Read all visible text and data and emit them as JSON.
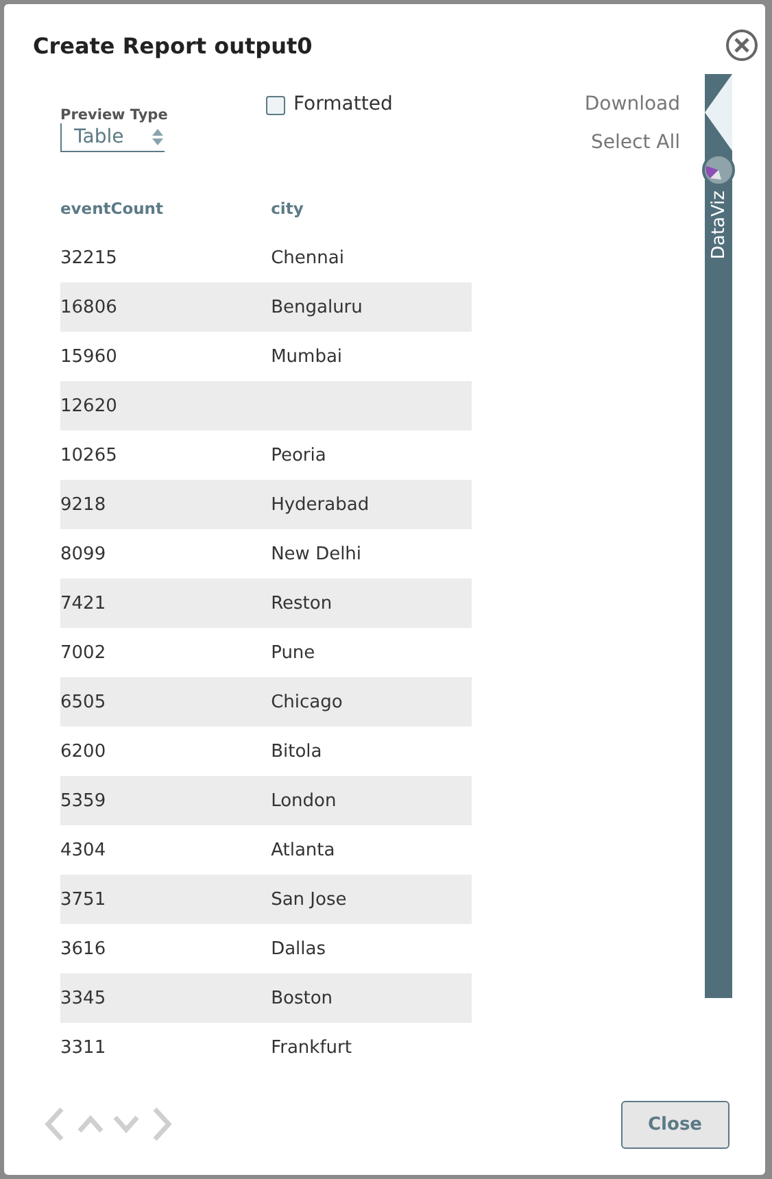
{
  "dialog": {
    "title": "Create Report output0"
  },
  "preview_type": {
    "label": "Preview Type",
    "value": "Table"
  },
  "formatted": {
    "label": "Formatted",
    "checked": false
  },
  "actions": [
    "Download",
    "Select All"
  ],
  "side_tab": {
    "label": "DataViz"
  },
  "table": {
    "columns": [
      "eventCount",
      "city"
    ],
    "rows": [
      [
        "32215",
        "Chennai"
      ],
      [
        "16806",
        "Bengaluru"
      ],
      [
        "15960",
        "Mumbai"
      ],
      [
        "12620",
        ""
      ],
      [
        "10265",
        "Peoria"
      ],
      [
        "9218",
        "Hyderabad"
      ],
      [
        "8099",
        "New Delhi"
      ],
      [
        "7421",
        "Reston"
      ],
      [
        "7002",
        "Pune"
      ],
      [
        "6505",
        "Chicago"
      ],
      [
        "6200",
        "Bitola"
      ],
      [
        "5359",
        "London"
      ],
      [
        "4304",
        "Atlanta"
      ],
      [
        "3751",
        "San Jose"
      ],
      [
        "3616",
        "Dallas"
      ],
      [
        "3345",
        "Boston"
      ],
      [
        "3311",
        "Frankfurt"
      ]
    ]
  },
  "close_button": {
    "label": "Close"
  }
}
